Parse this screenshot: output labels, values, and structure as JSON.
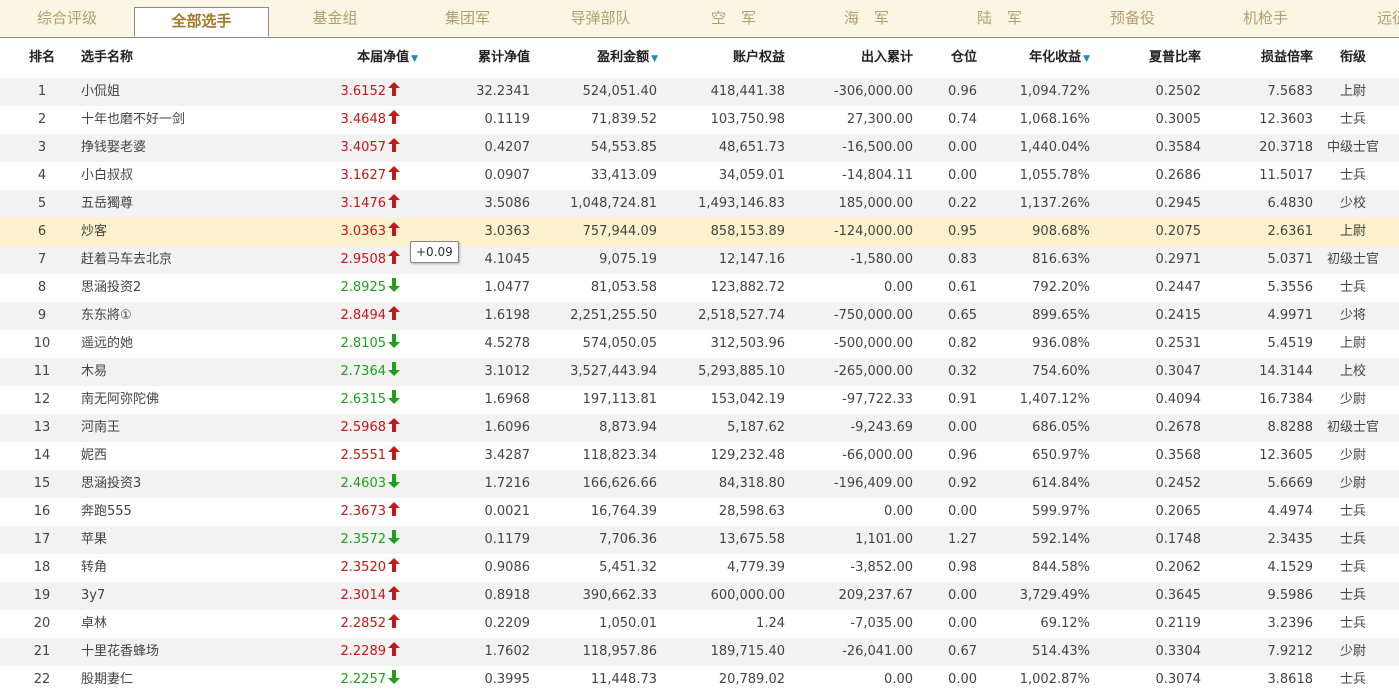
{
  "colors": {
    "up": "#c51818",
    "down": "#1ea21e",
    "sort_indicator": "#1e86c8",
    "highlight_row": "#fbf2cd"
  },
  "tabs": [
    {
      "label": "综合评级",
      "active": false
    },
    {
      "label": "全部选手",
      "active": true
    },
    {
      "label": "基金组",
      "active": false
    },
    {
      "label": "集团军",
      "active": false
    },
    {
      "label": "导弹部队",
      "active": false
    },
    {
      "label": "空　军",
      "active": false
    },
    {
      "label": "海　军",
      "active": false
    },
    {
      "label": "陆　军",
      "active": false
    },
    {
      "label": "预备役",
      "active": false
    },
    {
      "label": "机枪手",
      "active": false
    },
    {
      "label": "远征",
      "active": false
    }
  ],
  "columns": {
    "rank": "排名",
    "name": "选手名称",
    "nav": "本届净值",
    "cum_nav": "累计净值",
    "profit": "盈利金额",
    "equity": "账户权益",
    "flow": "出入累计",
    "position": "仓位",
    "annual": "年化收益",
    "sharpe": "夏普比率",
    "pl_ratio": "损益倍率",
    "title": "衔级"
  },
  "sort_indicators": {
    "nav": "▼",
    "profit": "▼",
    "annual": "▼"
  },
  "icons": {
    "up": "arrow-up-icon",
    "down": "arrow-down-icon"
  },
  "tooltip": "+0.09",
  "rows": [
    {
      "rank": "1",
      "name": "小侃姐",
      "nav": "3.6152",
      "dir": "up",
      "cum": "32.2341",
      "profit": "524,051.40",
      "equity": "418,441.38",
      "flow": "-306,000.00",
      "pos": "0.96",
      "annual": "1,094.72%",
      "sharpe": "0.2502",
      "pl": "7.5683",
      "title": "上尉"
    },
    {
      "rank": "2",
      "name": "十年也磨不好一剑",
      "nav": "3.4648",
      "dir": "up",
      "cum": "0.1119",
      "profit": "71,839.52",
      "equity": "103,750.98",
      "flow": "27,300.00",
      "pos": "0.74",
      "annual": "1,068.16%",
      "sharpe": "0.3005",
      "pl": "12.3603",
      "title": "士兵"
    },
    {
      "rank": "3",
      "name": "挣钱娶老婆",
      "nav": "3.4057",
      "dir": "up",
      "cum": "0.4207",
      "profit": "54,553.85",
      "equity": "48,651.73",
      "flow": "-16,500.00",
      "pos": "0.00",
      "annual": "1,440.04%",
      "sharpe": "0.3584",
      "pl": "20.3718",
      "title": "中级士官"
    },
    {
      "rank": "4",
      "name": "小白叔叔",
      "nav": "3.1627",
      "dir": "up",
      "cum": "0.0907",
      "profit": "33,413.09",
      "equity": "34,059.01",
      "flow": "-14,804.11",
      "pos": "0.00",
      "annual": "1,055.78%",
      "sharpe": "0.2686",
      "pl": "11.5017",
      "title": "士兵"
    },
    {
      "rank": "5",
      "name": "五岳獨尊",
      "nav": "3.1476",
      "dir": "up",
      "cum": "3.5086",
      "profit": "1,048,724.81",
      "equity": "1,493,146.83",
      "flow": "185,000.00",
      "pos": "0.22",
      "annual": "1,137.26%",
      "sharpe": "0.2945",
      "pl": "6.4830",
      "title": "少校"
    },
    {
      "rank": "6",
      "name": "炒客",
      "nav": "3.0363",
      "dir": "up",
      "cum": "3.0363",
      "profit": "757,944.09",
      "equity": "858,153.89",
      "flow": "-124,000.00",
      "pos": "0.95",
      "annual": "908.68%",
      "sharpe": "0.2075",
      "pl": "2.6361",
      "title": "上尉",
      "highlight": true
    },
    {
      "rank": "7",
      "name": "赶着马车去北京",
      "nav": "2.9508",
      "dir": "up",
      "cum": "4.1045",
      "profit": "9,075.19",
      "equity": "12,147.16",
      "flow": "-1,580.00",
      "pos": "0.83",
      "annual": "816.63%",
      "sharpe": "0.2971",
      "pl": "5.0371",
      "title": "初级士官"
    },
    {
      "rank": "8",
      "name": "思涵投资2",
      "nav": "2.8925",
      "dir": "down",
      "cum": "1.0477",
      "profit": "81,053.58",
      "equity": "123,882.72",
      "flow": "0.00",
      "pos": "0.61",
      "annual": "792.20%",
      "sharpe": "0.2447",
      "pl": "5.3556",
      "title": "士兵"
    },
    {
      "rank": "9",
      "name": "东东將①",
      "nav": "2.8494",
      "dir": "up",
      "cum": "1.6198",
      "profit": "2,251,255.50",
      "equity": "2,518,527.74",
      "flow": "-750,000.00",
      "pos": "0.65",
      "annual": "899.65%",
      "sharpe": "0.2415",
      "pl": "4.9971",
      "title": "少将"
    },
    {
      "rank": "10",
      "name": "遥远的她",
      "nav": "2.8105",
      "dir": "down",
      "cum": "4.5278",
      "profit": "574,050.05",
      "equity": "312,503.96",
      "flow": "-500,000.00",
      "pos": "0.82",
      "annual": "936.08%",
      "sharpe": "0.2531",
      "pl": "5.4519",
      "title": "上尉"
    },
    {
      "rank": "11",
      "name": "木易",
      "nav": "2.7364",
      "dir": "down",
      "cum": "3.1012",
      "profit": "3,527,443.94",
      "equity": "5,293,885.10",
      "flow": "-265,000.00",
      "pos": "0.32",
      "annual": "754.60%",
      "sharpe": "0.3047",
      "pl": "14.3144",
      "title": "上校"
    },
    {
      "rank": "12",
      "name": "南无阿弥陀佛",
      "nav": "2.6315",
      "dir": "down",
      "cum": "1.6968",
      "profit": "197,113.81",
      "equity": "153,042.19",
      "flow": "-97,722.33",
      "pos": "0.91",
      "annual": "1,407.12%",
      "sharpe": "0.4094",
      "pl": "16.7384",
      "title": "少尉"
    },
    {
      "rank": "13",
      "name": "河南王",
      "nav": "2.5968",
      "dir": "up",
      "cum": "1.6096",
      "profit": "8,873.94",
      "equity": "5,187.62",
      "flow": "-9,243.69",
      "pos": "0.00",
      "annual": "686.05%",
      "sharpe": "0.2678",
      "pl": "8.8288",
      "title": "初级士官"
    },
    {
      "rank": "14",
      "name": "妮西",
      "nav": "2.5551",
      "dir": "up",
      "cum": "3.4287",
      "profit": "118,823.34",
      "equity": "129,232.48",
      "flow": "-66,000.00",
      "pos": "0.96",
      "annual": "650.97%",
      "sharpe": "0.3568",
      "pl": "12.3605",
      "title": "少尉"
    },
    {
      "rank": "15",
      "name": "思涵投资3",
      "nav": "2.4603",
      "dir": "down",
      "cum": "1.7216",
      "profit": "166,626.66",
      "equity": "84,318.80",
      "flow": "-196,409.00",
      "pos": "0.92",
      "annual": "614.84%",
      "sharpe": "0.2452",
      "pl": "5.6669",
      "title": "少尉"
    },
    {
      "rank": "16",
      "name": "奔跑555",
      "nav": "2.3673",
      "dir": "up",
      "cum": "0.0021",
      "profit": "16,764.39",
      "equity": "28,598.63",
      "flow": "0.00",
      "pos": "0.00",
      "annual": "599.97%",
      "sharpe": "0.2065",
      "pl": "4.4974",
      "title": "士兵"
    },
    {
      "rank": "17",
      "name": "苹果",
      "nav": "2.3572",
      "dir": "down",
      "cum": "0.1179",
      "profit": "7,706.36",
      "equity": "13,675.58",
      "flow": "1,101.00",
      "pos": "1.27",
      "annual": "592.14%",
      "sharpe": "0.1748",
      "pl": "2.3435",
      "title": "士兵"
    },
    {
      "rank": "18",
      "name": "转角",
      "nav": "2.3520",
      "dir": "up",
      "cum": "0.9086",
      "profit": "5,451.32",
      "equity": "4,779.39",
      "flow": "-3,852.00",
      "pos": "0.98",
      "annual": "844.58%",
      "sharpe": "0.2062",
      "pl": "4.1529",
      "title": "士兵"
    },
    {
      "rank": "19",
      "name": "3y7",
      "nav": "2.3014",
      "dir": "up",
      "cum": "0.8918",
      "profit": "390,662.33",
      "equity": "600,000.00",
      "flow": "209,237.67",
      "pos": "0.00",
      "annual": "3,729.49%",
      "sharpe": "0.3645",
      "pl": "9.5986",
      "title": "士兵"
    },
    {
      "rank": "20",
      "name": "卓林",
      "nav": "2.2852",
      "dir": "up",
      "cum": "0.2209",
      "profit": "1,050.01",
      "equity": "1.24",
      "flow": "-7,035.00",
      "pos": "0.00",
      "annual": "69.12%",
      "sharpe": "0.2119",
      "pl": "3.2396",
      "title": "士兵"
    },
    {
      "rank": "21",
      "name": "十里花香蜂场",
      "nav": "2.2289",
      "dir": "up",
      "cum": "1.7602",
      "profit": "118,957.86",
      "equity": "189,715.40",
      "flow": "-26,041.00",
      "pos": "0.67",
      "annual": "514.43%",
      "sharpe": "0.3304",
      "pl": "7.9212",
      "title": "少尉"
    },
    {
      "rank": "22",
      "name": "股期妻仁",
      "nav": "2.2257",
      "dir": "down",
      "cum": "0.3995",
      "profit": "11,448.73",
      "equity": "20,789.02",
      "flow": "0.00",
      "pos": "0.00",
      "annual": "1,002.87%",
      "sharpe": "0.3074",
      "pl": "3.8618",
      "title": "士兵"
    }
  ]
}
